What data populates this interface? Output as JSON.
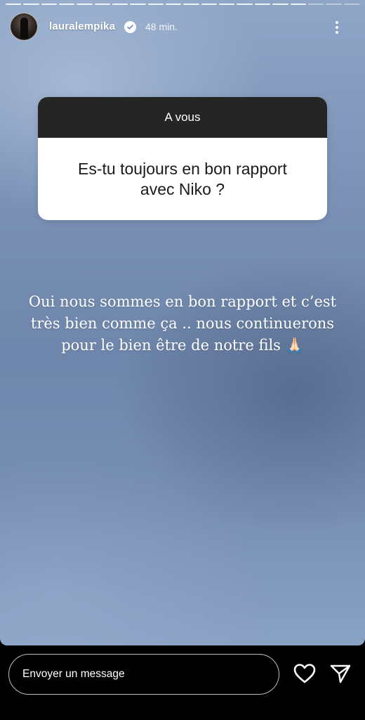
{
  "story": {
    "progress": {
      "segments": 20,
      "completed": 17
    },
    "header": {
      "username": "lauralempika",
      "time": "48 min.",
      "verified": true,
      "icons": {
        "verified": "verified-badge-icon",
        "more": "more-options-icon"
      }
    },
    "question": {
      "header": "A vous",
      "text": "Es-tu toujours en bon rapport avec Niko ?"
    },
    "answer": {
      "text": "Oui nous sommes en bon rapport et c’est très bien comme ça .. nous continuerons pour le bien être de notre fils 🙏🏻"
    }
  },
  "footer": {
    "message_placeholder": "Envoyer un message",
    "icons": {
      "like": "heart-icon",
      "share": "send-icon"
    }
  },
  "colors": {
    "background": "#000000",
    "question_header": "#252525",
    "accent": "#ffffff"
  }
}
